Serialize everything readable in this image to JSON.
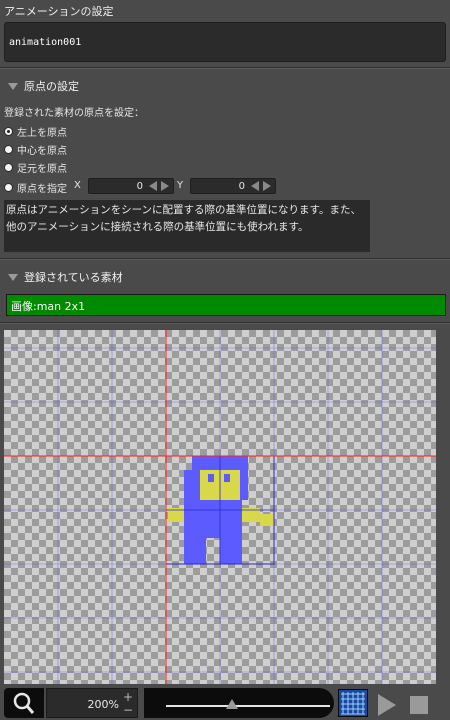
{
  "panel": {
    "title": "アニメーションの設定",
    "animation_name": "animation001"
  },
  "origin_section": {
    "header": "原点の設定",
    "label": "登録された素材の原点を設定：",
    "options": [
      "左上を原点",
      "中心を原点",
      "足元を原点",
      "原点を指定"
    ],
    "selected_index": 0,
    "x_label": "X",
    "x_value": "0",
    "y_label": "Y",
    "y_value": "0",
    "help_text": "原点はアニメーションをシーンに配置する際の基準位置になります。また、他のアニメーションに接続される際の基準位置にも使われます。"
  },
  "assets_section": {
    "header": "登録されている素材",
    "items": [
      "画像:man 2x1"
    ],
    "selected_color": "#008a00"
  },
  "canvas": {
    "guide_color": "#ff2020",
    "grid_color": "#3a3aff",
    "sprite_colors": {
      "body": "#5b5bff",
      "skin": "#d8d84a"
    }
  },
  "toolbar": {
    "zoom_value": "200%",
    "zoom_plus": "+",
    "zoom_minus": "−",
    "zoom_slider_fraction": 0.4,
    "grid_toggle_on": true
  },
  "icons": {
    "zoom": "magnifier-icon",
    "grid": "grid-icon",
    "play": "play-icon",
    "stop": "stop-icon",
    "collapse": "triangle-down-icon"
  }
}
